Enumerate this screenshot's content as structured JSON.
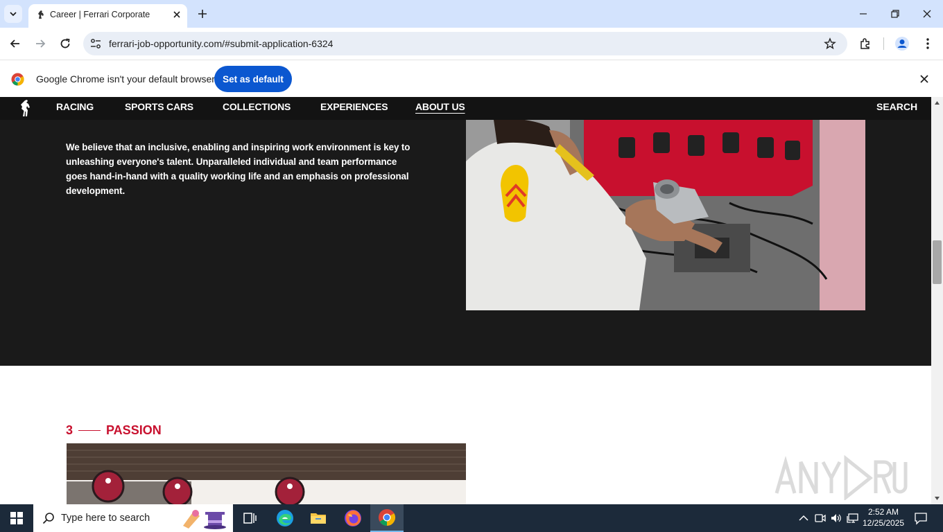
{
  "browser": {
    "tab_title": "Career | Ferrari Corporate",
    "url": "ferrari-job-opportunity.com/#submit-application-6324",
    "accent_color": "#0b57d0",
    "tabstrip_color": "#d3e3fd"
  },
  "infobar": {
    "message": "Google Chrome isn't your default browser",
    "button_label": "Set as default"
  },
  "site": {
    "nav": {
      "items": [
        "RACING",
        "SPORTS CARS",
        "COLLECTIONS",
        "EXPERIENCES",
        "ABOUT US"
      ],
      "active": "ABOUT US",
      "search_label": "SEARCH"
    },
    "paragraph": "We believe that an inclusive, enabling and inspiring work environment is key to unleashing everyone's talent. Unparalleled individual and team performance goes hand-in-hand with a quality working life and an emphasis on professional development.",
    "section": {
      "number": "3",
      "title": "PASSION",
      "color": "#c8102e"
    }
  },
  "taskbar": {
    "search_placeholder": "Type here to search",
    "time": "2:52 AM",
    "date": "12/25/2025"
  }
}
